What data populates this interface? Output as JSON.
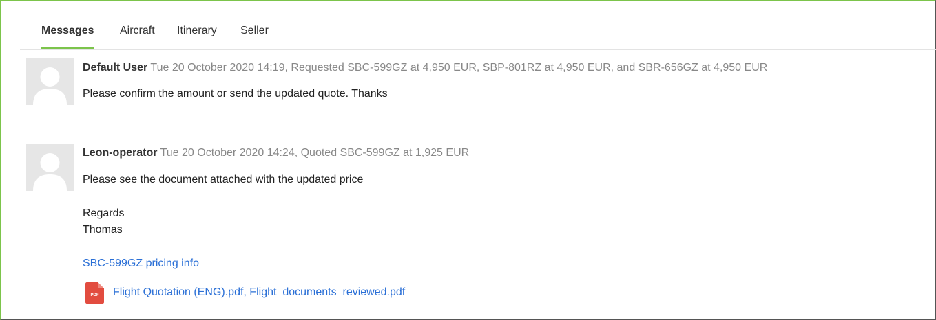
{
  "tabs": [
    {
      "label": "Messages",
      "active": true
    },
    {
      "label": "Aircraft",
      "active": false
    },
    {
      "label": "Itinerary",
      "active": false
    },
    {
      "label": "Seller",
      "active": false
    }
  ],
  "messages": [
    {
      "author": "Default User",
      "meta": "Tue 20 October 2020 14:19, Requested SBC-599GZ at 4,950 EUR, SBP-801RZ at 4,950 EUR, and SBR-656GZ at 4,950 EUR",
      "lines": [
        "Please confirm the amount or send the updated quote. Thanks"
      ]
    },
    {
      "author": "Leon-operator",
      "meta": "Tue 20 October 2020 14:24, Quoted SBC-599GZ at 1,925 EUR",
      "lines": [
        "Please see the document attached with the updated price",
        "Regards",
        "Thomas"
      ],
      "link": "SBC-599GZ pricing info",
      "attachments": "Flight Quotation (ENG).pdf, Flight_documents_reviewed.pdf",
      "attachment_icon": "pdf-file-icon",
      "attachment_icon_label": "PDF"
    }
  ],
  "colors": {
    "accent_green": "#7cc44b",
    "link_blue": "#2a6fd6",
    "meta_gray": "#888888",
    "pdf_red": "#e24c3f"
  }
}
